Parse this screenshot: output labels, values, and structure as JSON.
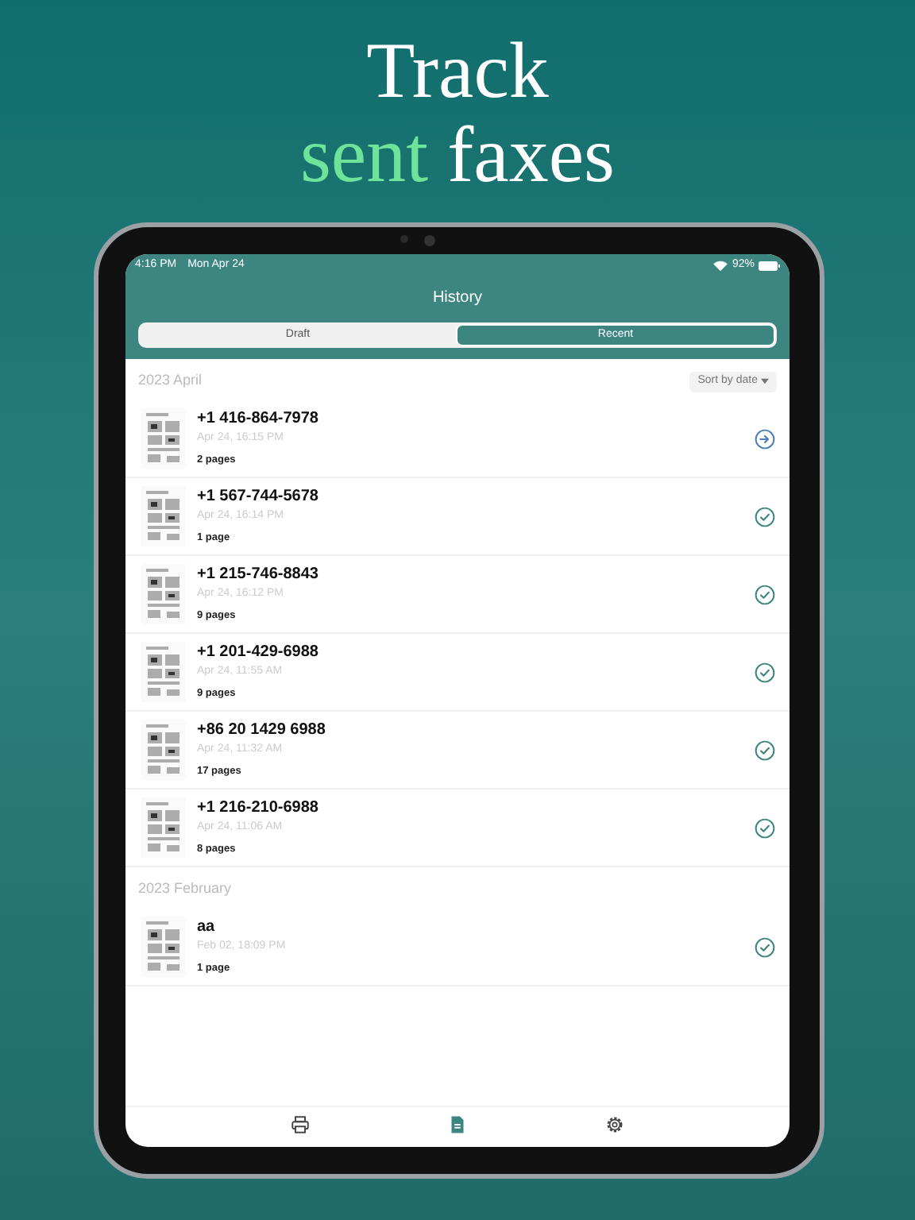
{
  "headline": {
    "line_1": "Track",
    "highlight": "sent",
    "rest": "faxes"
  },
  "status_bar": {
    "time": "4:16 PM",
    "date": "Mon Apr 24",
    "battery": "92%"
  },
  "title": "History",
  "segments": [
    {
      "label": "Draft",
      "selected": false
    },
    {
      "label": "Recent",
      "selected": true
    }
  ],
  "sort_button": "Sort by date",
  "sections": [
    {
      "title": "2023 April",
      "items": [
        {
          "number": "+1 416-864-7978",
          "time": "Apr 24, 16:15 PM",
          "pages": "2 pages",
          "kind": "sending"
        },
        {
          "number": "+1 567-744-5678",
          "time": "Apr 24, 16:14 PM",
          "pages": "1 page",
          "kind": "sent"
        },
        {
          "number": "+1 215-746-8843",
          "time": "Apr 24, 16:12 PM",
          "pages": "9 pages",
          "kind": "sent"
        },
        {
          "number": "+1 201-429-6988",
          "time": "Apr 24, 11:55 AM",
          "pages": "9 pages",
          "kind": "sent"
        },
        {
          "number": "+86 20 1429 6988",
          "time": "Apr 24, 11:32 AM",
          "pages": "17 pages",
          "kind": "sent"
        },
        {
          "number": "+1 216-210-6988",
          "time": "Apr 24, 11:06 AM",
          "pages": "8 pages",
          "kind": "sent"
        }
      ]
    },
    {
      "title": "2023 February",
      "items": [
        {
          "number": "aa",
          "time": "Feb 02, 18:09 PM",
          "pages": "1 page",
          "kind": "sent"
        }
      ]
    }
  ],
  "tab_bar": [
    {
      "kind": "printer",
      "selected": false
    },
    {
      "kind": "document",
      "selected": true
    },
    {
      "kind": "settings",
      "selected": false
    }
  ]
}
